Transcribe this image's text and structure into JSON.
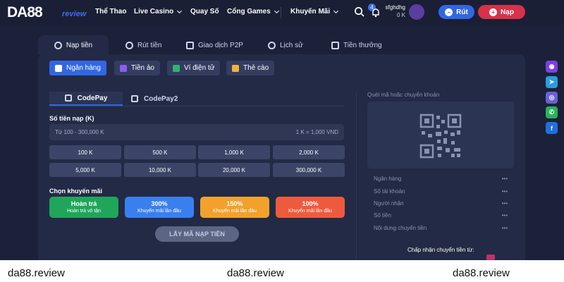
{
  "header": {
    "logo_text": "DA88",
    "logo_sub": "review",
    "nav": [
      "Thể Thao",
      "Live Casino",
      "Quay Số",
      "Cổng Games",
      "Khuyến Mãi"
    ],
    "notif_count": "4",
    "username": "sfghdhg",
    "balance": "0 K",
    "rut_label": "Rút",
    "nap_label": "Nạp"
  },
  "tabs": [
    "Nạp tiền",
    "Rút tiền",
    "Giao dịch P2P",
    "Lịch sử",
    "Tiền thưởng"
  ],
  "methods": [
    "Ngân hàng",
    "Tiền ảo",
    "Ví điện tử",
    "Thẻ cào"
  ],
  "subtabs": [
    "CodePay",
    "CodePay2"
  ],
  "amount": {
    "label": "Số tiền nạp (K)",
    "placeholder": "Từ 100 - 300,000 K",
    "rate": "1 K = 1,000 VND"
  },
  "quick_amounts": [
    "100 K",
    "500 K",
    "1,000 K",
    "2,000 K",
    "5,000 K",
    "10,000 K",
    "20,000 K",
    "300,000 K"
  ],
  "promo": {
    "label": "Chọn khuyến mãi",
    "items": [
      {
        "title": "Hoàn trả",
        "sub": "Hoàn trả vô tận"
      },
      {
        "title": "300%",
        "sub": "Khuyến mãi lần đầu"
      },
      {
        "title": "150%",
        "sub": "Khuyến mãi lần đầu"
      },
      {
        "title": "100%",
        "sub": "Khuyến mãi lần đầu"
      }
    ]
  },
  "get_code": "LẤY MÃ NẠP TIỀN",
  "right": {
    "title": "Quét mã hoặc chuyển khoản",
    "fields": [
      "Ngân hàng",
      "Số tài khoản",
      "Người nhận",
      "Số tiền",
      "Nội dung chuyển tiền"
    ],
    "field_value": "•••",
    "accept": "Chấp nhận chuyển tiền từ:"
  },
  "footer": [
    "da88.review",
    "da88.review",
    "da88.review"
  ],
  "colors": {
    "primary": "#3267e3",
    "danger": "#d8314a",
    "green": "#1fa65a",
    "blue": "#3a7ff0",
    "orange": "#f2a12c",
    "red": "#ee5a3d"
  }
}
